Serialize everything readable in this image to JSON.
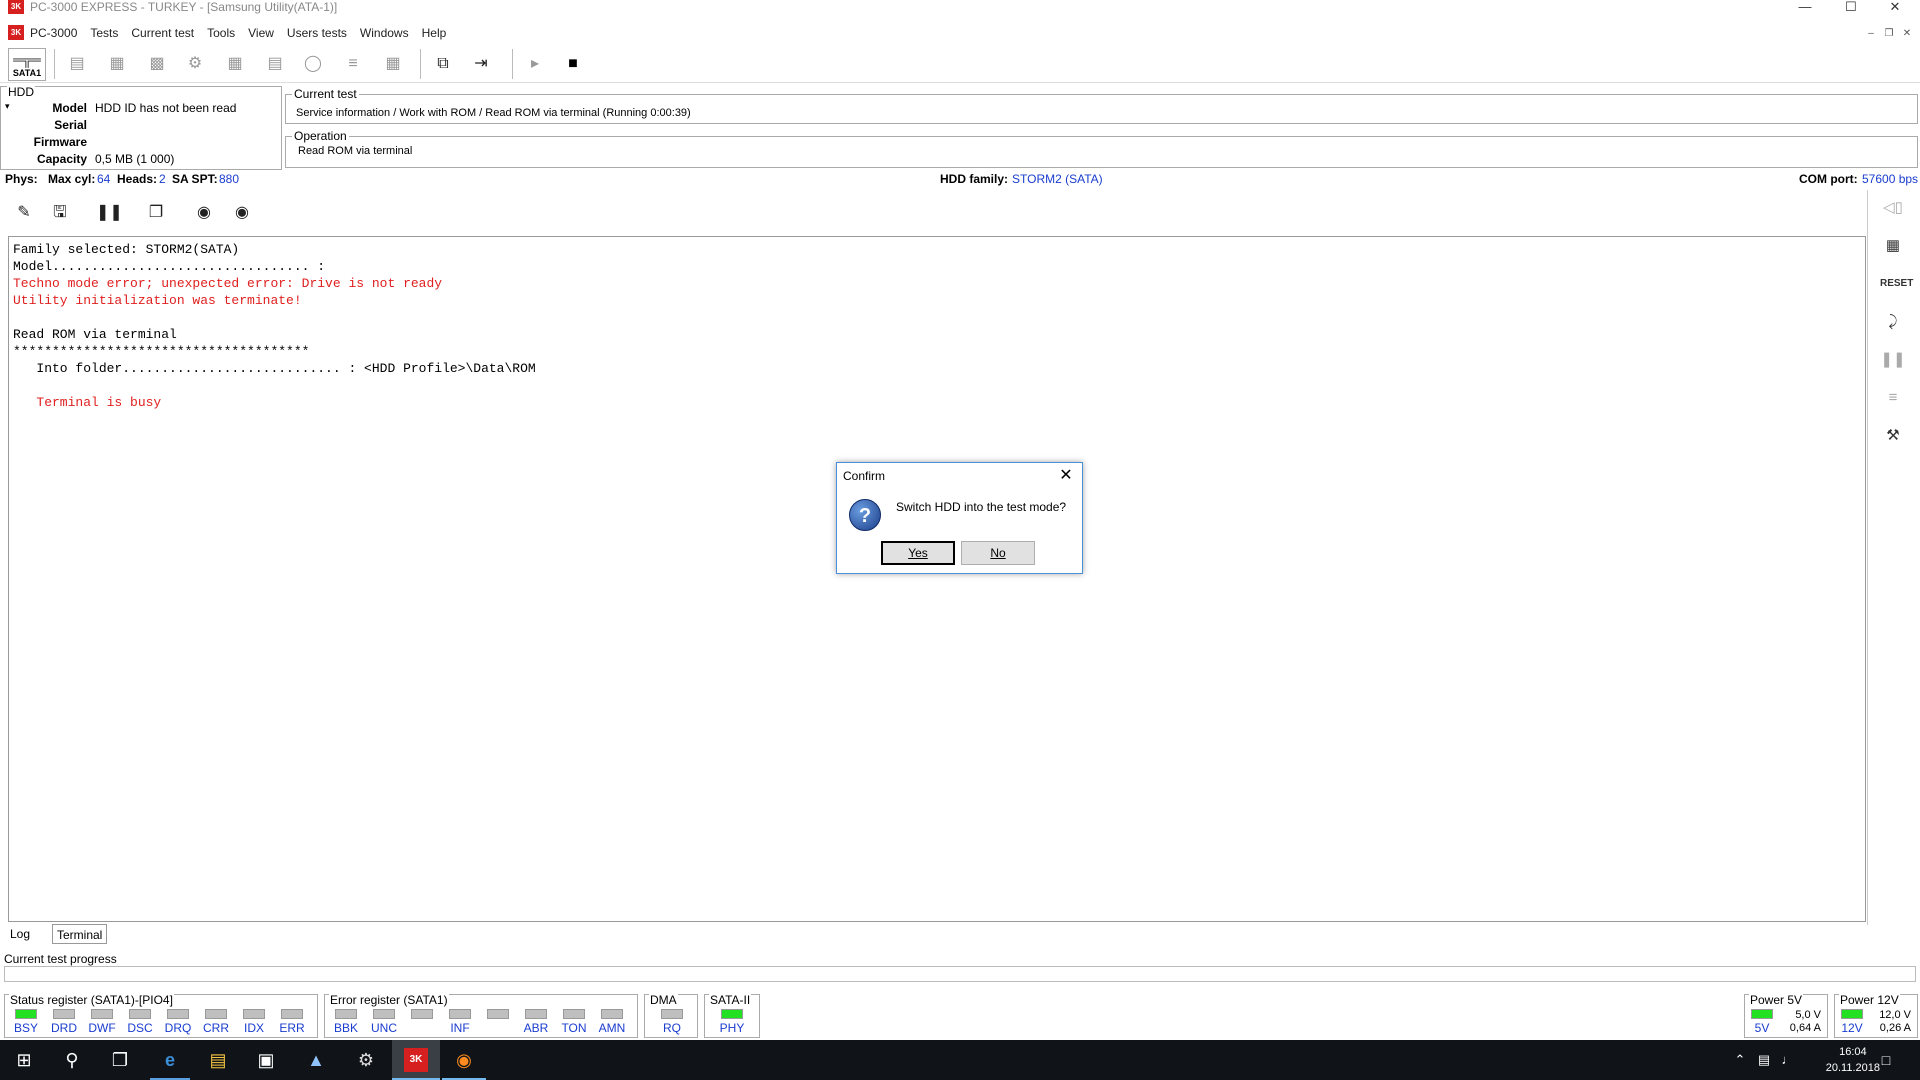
{
  "window": {
    "title": "PC-3000 EXPRESS - TURKEY - [Samsung Utility(ATA-1)]",
    "app_icon_text": "3K"
  },
  "menu": {
    "items": [
      "PC-3000",
      "Tests",
      "Current test",
      "Tools",
      "View",
      "Users tests",
      "Windows",
      "Help"
    ]
  },
  "toolbar": {
    "sata_label": "SATA1"
  },
  "hdd": {
    "legend": "HDD",
    "model_label": "Model",
    "model_value": "HDD ID has not been read",
    "serial_label": "Serial",
    "serial_value": "",
    "firmware_label": "Firmware",
    "firmware_value": "",
    "capacity_label": "Capacity",
    "capacity_value": "0,5 MB (1 000)"
  },
  "current_test": {
    "legend": "Current test",
    "value": "Service information / Work with ROM / Read ROM via terminal (Running 0:00:39)"
  },
  "operation": {
    "legend": "Operation",
    "value": "Read ROM via terminal"
  },
  "phys": {
    "phys_label": "Phys:",
    "maxcyl_label": "Max cyl:",
    "maxcyl_value": "64",
    "heads_label": "Heads:",
    "heads_value": "2",
    "saspt_label": "SA SPT:",
    "saspt_value": "880",
    "family_label": "HDD family:",
    "family_value": "STORM2 (SATA)",
    "com_label": "COM port:",
    "com_value": "57600 bps"
  },
  "log": {
    "lines": [
      {
        "text": "Family selected: STORM2(SATA)",
        "error": false
      },
      {
        "text": "Model................................. :",
        "error": false
      },
      {
        "text": "Techno mode error; unexpected error: Drive is not ready",
        "error": true
      },
      {
        "text": "Utility initialization was terminate!",
        "error": true
      },
      {
        "text": "",
        "error": false
      },
      {
        "text": "Read ROM via terminal",
        "error": false
      },
      {
        "text": "**************************************",
        "error": false
      },
      {
        "text": "   Into folder............................ : <HDD Profile>\\Data\\ROM",
        "error": false
      },
      {
        "text": "",
        "error": false
      },
      {
        "text": "   Terminal is busy",
        "error": true
      }
    ]
  },
  "tabs": {
    "log": "Log",
    "terminal": "Terminal"
  },
  "progress": {
    "label": "Current test progress",
    "fraction": 0
  },
  "status_register": {
    "legend": "Status register (SATA1)-[PIO4]",
    "leds": [
      {
        "label": "BSY",
        "on": true
      },
      {
        "label": "DRD",
        "on": false
      },
      {
        "label": "DWF",
        "on": false
      },
      {
        "label": "DSC",
        "on": false
      },
      {
        "label": "DRQ",
        "on": false
      },
      {
        "label": "CRR",
        "on": false
      },
      {
        "label": "IDX",
        "on": false
      },
      {
        "label": "ERR",
        "on": false
      }
    ]
  },
  "error_register": {
    "legend": "Error register (SATA1)",
    "leds": [
      {
        "label": "BBK",
        "on": false
      },
      {
        "label": "UNC",
        "on": false
      },
      {
        "label": "",
        "on": false
      },
      {
        "label": "INF",
        "on": false
      },
      {
        "label": "",
        "on": false
      },
      {
        "label": "ABR",
        "on": false
      },
      {
        "label": "TON",
        "on": false
      },
      {
        "label": "AMN",
        "on": false
      }
    ]
  },
  "dma": {
    "legend": "DMA",
    "led_label": "RQ",
    "on": false
  },
  "sata2": {
    "legend": "SATA-II",
    "led_label": "PHY",
    "on": true
  },
  "power5": {
    "legend": "Power 5V",
    "led_label": "5V",
    "voltage": "5,0 V",
    "current": "0,64 A"
  },
  "power12": {
    "legend": "Power 12V",
    "led_label": "12V",
    "voltage": "12,0 V",
    "current": "0,26 A"
  },
  "dialog": {
    "title": "Confirm",
    "message": "Switch HDD into the test mode?",
    "yes": "Yes",
    "no": "No"
  },
  "taskbar": {
    "time": "16:04",
    "date": "20.11.2018"
  },
  "colors": {
    "accent_blue": "#1a3ccf",
    "error_red": "#e02020",
    "led_on": "#22e022",
    "led_off": "#bfbfbf"
  }
}
